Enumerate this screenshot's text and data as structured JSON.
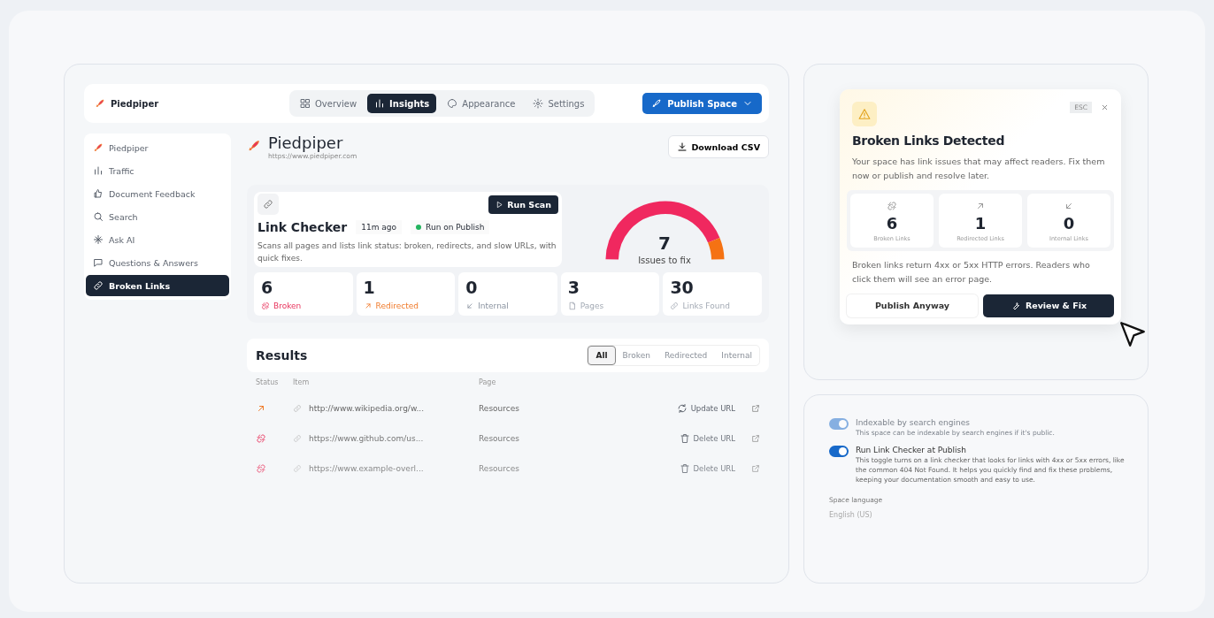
{
  "topbar": {
    "brand": "Piedpiper",
    "tabs": [
      {
        "label": "Overview",
        "selected": false
      },
      {
        "label": "Insights",
        "selected": true
      },
      {
        "label": "Appearance",
        "selected": false
      },
      {
        "label": "Settings",
        "selected": false
      }
    ],
    "publish_button": "Publish Space"
  },
  "sidebar": {
    "items": [
      {
        "label": "Piedpiper",
        "selected": false
      },
      {
        "label": "Traffic",
        "selected": false
      },
      {
        "label": "Document Feedback",
        "selected": false
      },
      {
        "label": "Search",
        "selected": false
      },
      {
        "label": "Ask AI",
        "selected": false
      },
      {
        "label": "Questions & Answers",
        "selected": false
      },
      {
        "label": "Broken Links",
        "selected": true
      }
    ]
  },
  "header": {
    "title": "Piedpiper",
    "url": "https://www.piedpiper.com",
    "download_button": "Download CSV"
  },
  "link_checker": {
    "title": "Link Checker",
    "time": "11m ago",
    "status": "Run on Publish",
    "description": "Scans all pages and lists link status: broken, redirects, and slow URLs, with quick fixes.",
    "run_button": "Run Scan",
    "gauge": {
      "value": "7",
      "caption": "Issues to fix"
    },
    "stats": [
      {
        "value": "6",
        "label": "Broken",
        "kind": "broken"
      },
      {
        "value": "1",
        "label": "Redirected",
        "kind": "redirected"
      },
      {
        "value": "0",
        "label": "Internal",
        "kind": "internal"
      },
      {
        "value": "3",
        "label": "Pages",
        "kind": "pages"
      },
      {
        "value": "30",
        "label": "Links Found",
        "kind": "links"
      }
    ]
  },
  "results": {
    "title": "Results",
    "filters": [
      {
        "label": "All",
        "selected": true
      },
      {
        "label": "Broken",
        "selected": false
      },
      {
        "label": "Redirected",
        "selected": false
      },
      {
        "label": "Internal",
        "selected": false
      }
    ],
    "columns": [
      "Status",
      "Item",
      "Page"
    ],
    "rows": [
      {
        "kind": "redirected",
        "item": "http://www.wikipedia.org/w...",
        "page": "Resources",
        "action_label": "Update URL"
      },
      {
        "kind": "broken",
        "item": "https://www.github.com/us...",
        "page": "Resources",
        "action_label": "Delete URL"
      },
      {
        "kind": "broken",
        "item": "https://www.example-overl...",
        "page": "Resources",
        "action_label": "Delete URL"
      }
    ]
  },
  "dialog": {
    "esc": "ESC",
    "title": "Broken Links Detected",
    "message": "Your space has link issues that may affect readers. Fix them now or publish and resolve later.",
    "stats": [
      {
        "value": "6",
        "label": "Broken Links",
        "kind": "broken"
      },
      {
        "value": "1",
        "label": "Redirected Links",
        "kind": "redirected"
      },
      {
        "value": "0",
        "label": "Internal Links",
        "kind": "internal"
      }
    ],
    "note": "Broken links return 4xx or 5xx HTTP errors. Readers who click them will see an error page.",
    "secondary_button": "Publish Anyway",
    "primary_button": "Review & Fix"
  },
  "settings": {
    "toggles": [
      {
        "title": "Indexable by search engines",
        "description": "This space can be indexable by search engines if it's public.",
        "on": true,
        "disabled": true
      },
      {
        "title": "Run Link Checker at Publish",
        "description": "This toggle turns on a link checker that looks for links with 4xx or 5xx errors, like the common 404 Not Found. It helps you quickly find and fix these problems, keeping your documentation smooth and easy to use.",
        "on": true,
        "disabled": false
      }
    ],
    "language_label": "Space language",
    "language_value": "English (US)"
  }
}
